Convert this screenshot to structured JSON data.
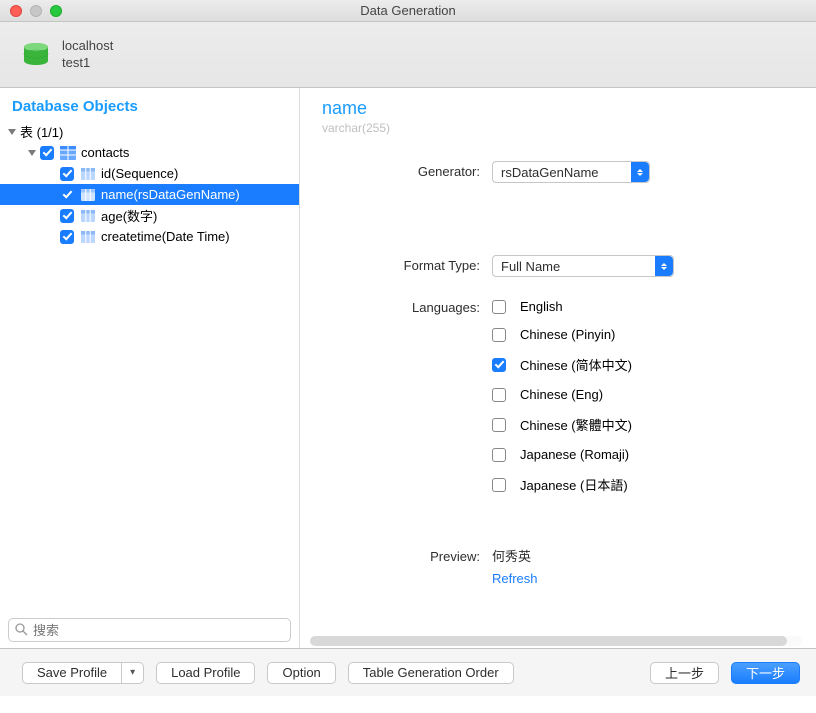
{
  "window": {
    "title": "Data Generation"
  },
  "header": {
    "host": "localhost",
    "db": "test1"
  },
  "sidebar": {
    "title": "Database Objects",
    "tableGroupLabel": "表 (1/1)",
    "tableName": "contacts",
    "columns": [
      {
        "label": "id(Sequence)",
        "checked": true,
        "selected": false
      },
      {
        "label": "name(rsDataGenName)",
        "checked": true,
        "selected": true
      },
      {
        "label": "age(数字)",
        "checked": true,
        "selected": false
      },
      {
        "label": "createtime(Date Time)",
        "checked": true,
        "selected": false
      }
    ],
    "searchPlaceholder": "搜索"
  },
  "detail": {
    "fieldName": "name",
    "fieldType": "varchar(255)",
    "labels": {
      "generator": "Generator:",
      "formatType": "Format Type:",
      "languages": "Languages:",
      "preview": "Preview:"
    },
    "generatorValue": "rsDataGenName",
    "formatTypeValue": "Full Name",
    "languages": [
      {
        "label": "English",
        "checked": false
      },
      {
        "label": "Chinese (Pinyin)",
        "checked": false
      },
      {
        "label": "Chinese (简体中文)",
        "checked": true
      },
      {
        "label": "Chinese (Eng)",
        "checked": false
      },
      {
        "label": "Chinese (繁體中文)",
        "checked": false
      },
      {
        "label": "Japanese (Romaji)",
        "checked": false
      },
      {
        "label": "Japanese (日本語)",
        "checked": false
      }
    ],
    "previewValue": "何秀英",
    "refreshLabel": "Refresh"
  },
  "footer": {
    "saveProfile": "Save Profile",
    "loadProfile": "Load Profile",
    "option": "Option",
    "tableOrder": "Table Generation Order",
    "back": "上一步",
    "next": "下一步"
  }
}
